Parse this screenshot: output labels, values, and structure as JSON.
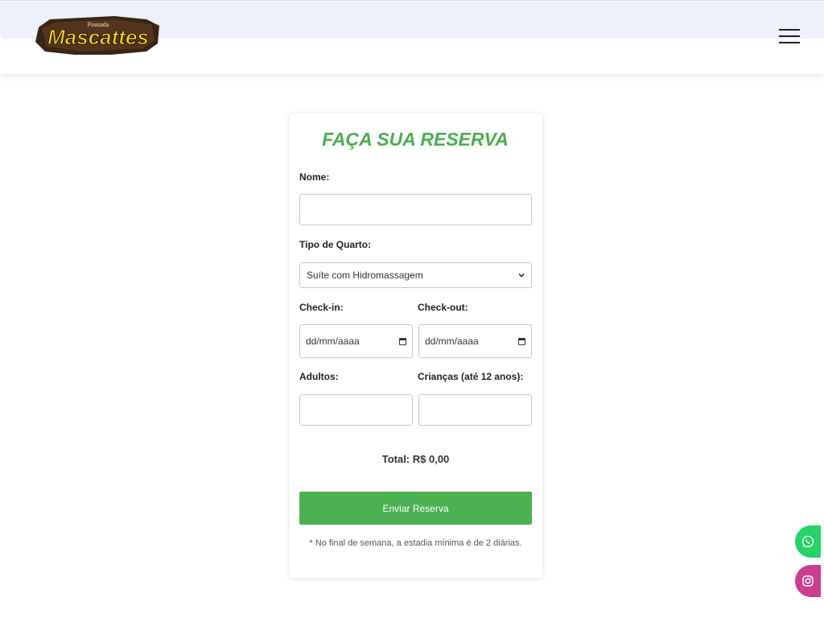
{
  "header": {
    "logo_small": "Pousada",
    "logo_text": "Mascattes",
    "menu_icon": "hamburger-menu-icon"
  },
  "form": {
    "title": "FAÇA SUA RESERVA",
    "name_label": "Nome:",
    "name_value": "",
    "room_label": "Tipo de Quarto:",
    "room_value": "Suíte com Hidromassagem",
    "checkin_label": "Check-in:",
    "checkin_value": "dd/mm/aaaa",
    "checkout_label": "Check-out:",
    "checkout_value": "dd/mm/aaaa",
    "adults_label": "Adultos:",
    "adults_value": "",
    "children_label": "Crianças (até 12 anos):",
    "children_value": "",
    "total_text": "Total: R$ 0,00",
    "submit_label": "Enviar Reserva",
    "note": "* No final de semana, a estadia mínima é de 2 diárias."
  },
  "floating": {
    "whatsapp_icon": "whatsapp-icon",
    "instagram_icon": "instagram-icon"
  },
  "colors": {
    "accent_green": "#4caf50",
    "whatsapp": "#25d366",
    "instagram": "#c93e8e",
    "logo_yellow": "#f5d51b"
  }
}
